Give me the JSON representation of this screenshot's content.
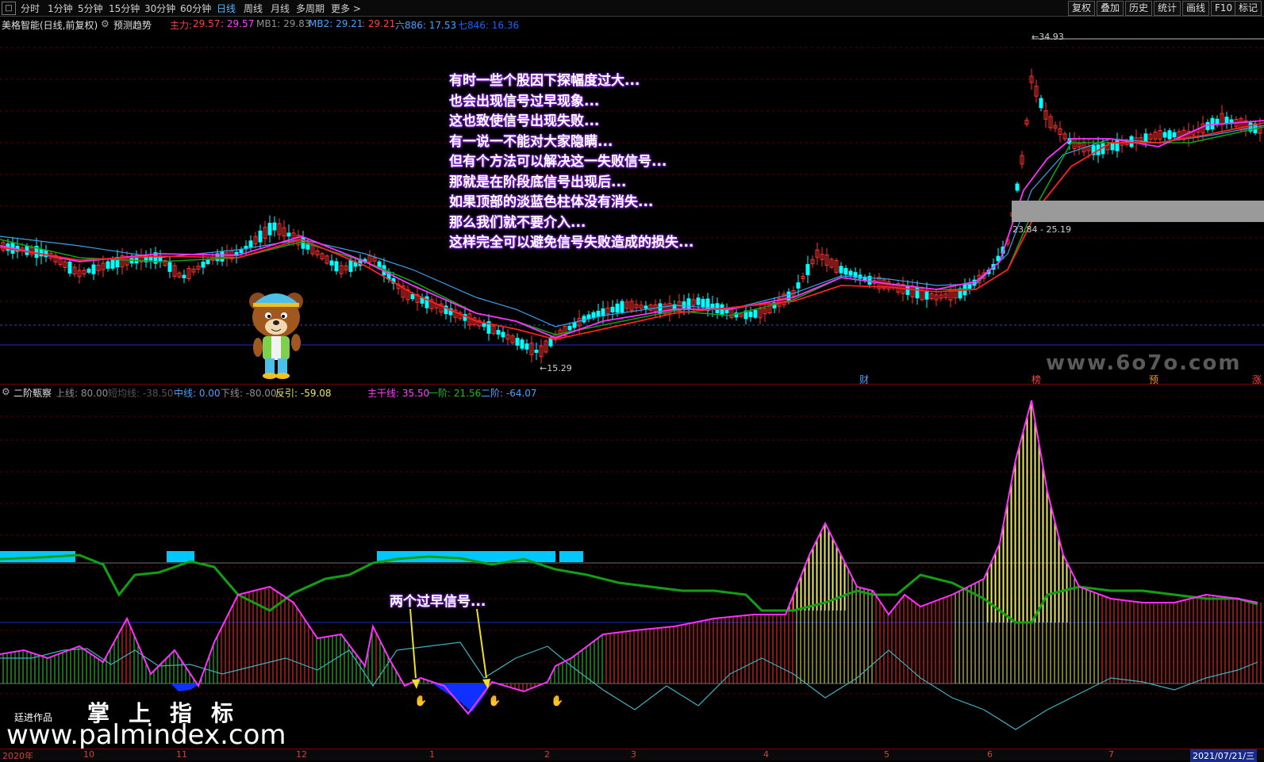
{
  "toolbar": {
    "left_icon": "menu-square-icon",
    "periods": [
      "分时",
      "1分钟",
      "5分钟",
      "15分钟",
      "30分钟",
      "60分钟",
      "日线",
      "周线",
      "月线",
      "多周期",
      "更多 >"
    ],
    "active_period": "日线",
    "right_buttons": [
      "复权",
      "叠加",
      "历史",
      "统计",
      "画线",
      "F10",
      "标记"
    ]
  },
  "info": {
    "stock": "美格智能(日线,前复权)",
    "predict": "预测趋势",
    "zhuli_label": "主力:",
    "zhuli_val1": "29.57",
    "zhuli_val2": ": 29.57",
    "mb1": "MB1: 29.83",
    "mb2": "MB2: 29.21",
    "mb2_b": ": 29.21",
    "liu": "六886: 17.53",
    "qi": "七846: 16.36"
  },
  "main": {
    "annotation_lines": [
      "有时一些个股因下探幅度过大...",
      "也会出现信号过早现象...",
      "这也致使信号出现失败...",
      "有一说一不能对大家隐瞒...",
      "但有个方法可以解决这一失败信号...",
      "那就是在阶段底信号出现后...",
      "如果顶部的淡蓝色柱体没有消失...",
      "那么我们就不要介入...",
      "这样完全可以避免信号失败造成的损失..."
    ],
    "low_label": "←15.29",
    "high_label": "←34.93",
    "range_label": "23.84 - 25.19",
    "watermark": "www.6o7o.com",
    "markers": [
      {
        "text": "财",
        "color": "#4aa0ff"
      },
      {
        "text": "榜",
        "color": "#ff4040"
      },
      {
        "text": "预",
        "color": "#ff8c00"
      },
      {
        "text": "涨",
        "color": "#ff4040"
      }
    ]
  },
  "indicator": {
    "name": "二阶甄察",
    "shang": "上线: 80.00",
    "zhong_hide": "短均线: -38.50",
    "zhong": "中线: 0.00",
    "xia": "下线: -80.00",
    "fanyin": "反引: -59.08",
    "zhugan": "主干线: 35.50",
    "yijie": "一阶: 21.56",
    "erjie": "二阶: -64.07",
    "note": "两个过早信号...",
    "credit": "廷进作品",
    "brand": "掌上指标",
    "site": "www.palmindex.com"
  },
  "dates": {
    "labels": [
      "2020年",
      "10",
      "11",
      "12",
      "1",
      "2",
      "3",
      "4",
      "5",
      "6",
      "7"
    ],
    "current": "2021/07/21/三"
  },
  "colors": {
    "up": "#ff3030",
    "down": "#00ffff",
    "ma_pink": "#ff30ff",
    "ma_red": "#ff2020",
    "ma_green": "#12a012",
    "ma_blue": "#3aa0e8",
    "cyan_bar": "#00c8ff",
    "yellow_bar": "#e8e860"
  }
}
